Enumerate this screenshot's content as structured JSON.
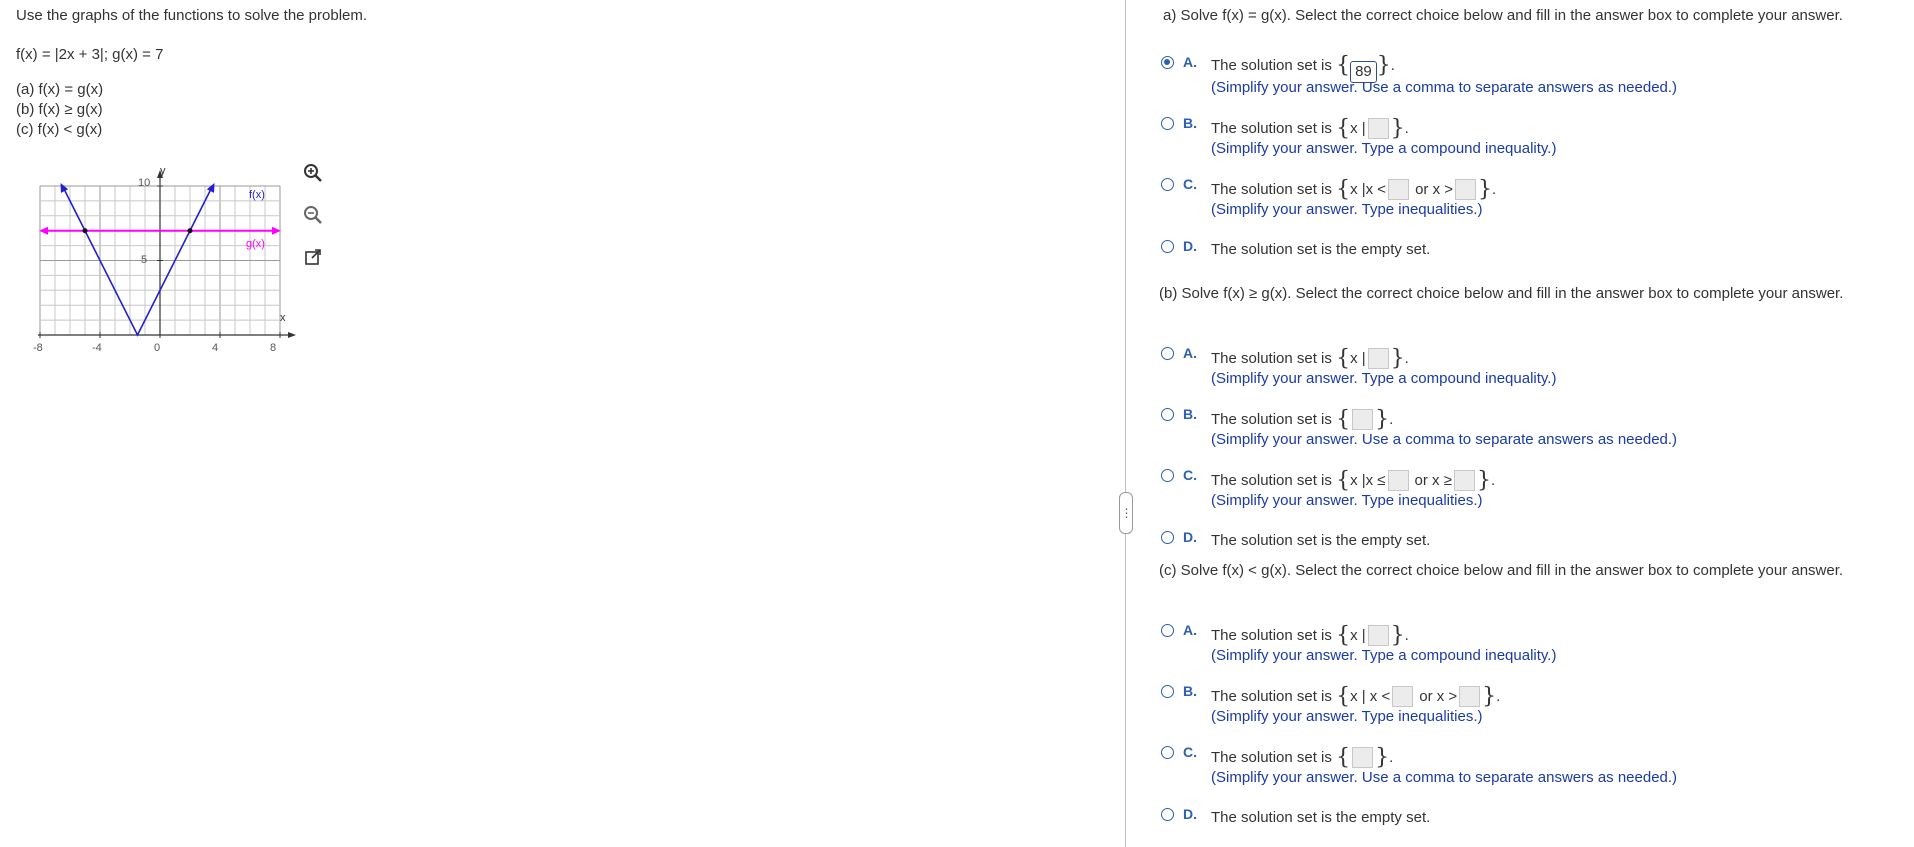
{
  "left": {
    "instruction": "Use the graphs of the functions to solve the problem.",
    "functions": "f(x) = |2x + 3|; g(x) = 7",
    "parts": [
      "(a) f(x) = g(x)",
      "(b) f(x) ≥ g(x)",
      "(c) f(x) < g(x)"
    ],
    "graph": {
      "axis_y": "y",
      "axis_x": "x",
      "label_f": "f(x)",
      "label_g": "g(x)",
      "y_ticks": [
        "10",
        "5"
      ],
      "x_ticks": [
        "-8",
        "-4",
        "0",
        "4",
        "8"
      ],
      "xlim": [
        -8,
        8
      ],
      "ylim": [
        0,
        10
      ],
      "f_color": "#1f1fd6",
      "g_color": "#ff00ff"
    },
    "tools": [
      "zoom-in-icon",
      "zoom-out-icon",
      "popout-icon"
    ]
  },
  "handle_text": "⋮",
  "parts": [
    {
      "header": "a) Solve f(x) = g(x). Select the correct choice below and fill in the answer box to complete your answer.",
      "choices": [
        {
          "letter": "A.",
          "selected": true,
          "pre": "The solution set is ",
          "a1": "",
          "mid": "",
          "a2": "",
          "post": ".",
          "answer": "89",
          "hint": "(Simplify your answer. Use a comma to separate answers as needed.)"
        },
        {
          "letter": "B.",
          "selected": false,
          "pre": "The solution set is ",
          "a1": "x |",
          "hint": "(Simplify your answer. Type a compound inequality.)"
        },
        {
          "letter": "C.",
          "selected": false,
          "pre": "The solution set is ",
          "a1": "x |x <",
          "mid": "or x >",
          "hint": "(Simplify your answer. Type inequalities.)"
        },
        {
          "letter": "D.",
          "selected": false,
          "text": "The solution set is the empty set."
        }
      ]
    },
    {
      "header": "(b) Solve f(x) ≥ g(x). Select the correct choice below and fill in the answer box to complete your answer.",
      "choices": [
        {
          "letter": "A.",
          "selected": false,
          "pre": "The solution set is ",
          "a1": "x |",
          "hint": "(Simplify your answer. Type a compound inequality.)"
        },
        {
          "letter": "B.",
          "selected": false,
          "pre": "The solution set is ",
          "a1": "",
          "hint": "(Simplify your answer. Use a comma to separate answers as needed.)"
        },
        {
          "letter": "C.",
          "selected": false,
          "pre": "The solution set is ",
          "a1": "x |x ≤",
          "mid": "or x ≥",
          "hint": "(Simplify your answer. Type inequalities.)"
        },
        {
          "letter": "D.",
          "selected": false,
          "text": "The solution set is the empty set."
        }
      ]
    },
    {
      "header": "(c) Solve f(x) < g(x). Select the correct choice below and fill in the answer box to complete your answer.",
      "choices": [
        {
          "letter": "A.",
          "selected": false,
          "pre": "The solution set is ",
          "a1": "x |",
          "hint": "(Simplify your answer. Type a compound inequality.)"
        },
        {
          "letter": "B.",
          "selected": false,
          "pre": "The solution set is ",
          "a1": "x | x <",
          "mid": "or x >",
          "hint": "(Simplify your answer. Type inequalities.)"
        },
        {
          "letter": "C.",
          "selected": false,
          "pre": "The solution set is ",
          "a1": "",
          "hint": "(Simplify your answer. Use a comma to separate answers as needed.)"
        },
        {
          "letter": "D.",
          "selected": false,
          "text": "The solution set is the empty set."
        }
      ]
    }
  ]
}
